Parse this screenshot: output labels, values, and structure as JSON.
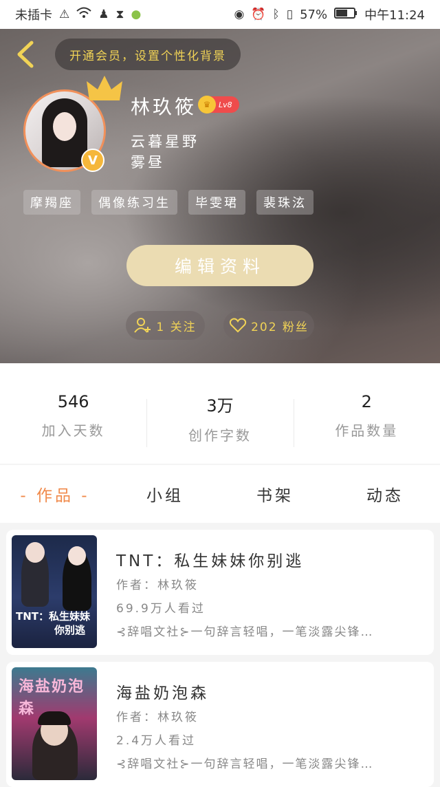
{
  "status_bar": {
    "carrier": "未插卡",
    "battery": "57%",
    "time": "中午11:24"
  },
  "header": {
    "vip_banner": "开通会员，设置个性化背景"
  },
  "profile": {
    "name": "林玖筱",
    "level": "Lv8",
    "bio_line1": "云暮星野",
    "bio_line2": "雾昼",
    "tags": [
      "摩羯座",
      "偶像练习生",
      "毕雯珺",
      "裴珠泫"
    ],
    "edit_button": "编辑资料",
    "follow_label": "1 关注",
    "fans_label": "202 粉丝"
  },
  "stats": [
    {
      "value": "546",
      "label": "加入天数"
    },
    {
      "value": "3万",
      "label": "创作字数"
    },
    {
      "value": "2",
      "label": "作品数量"
    }
  ],
  "tabs": [
    {
      "label": "- 作品 -",
      "active": true
    },
    {
      "label": "小组",
      "active": false
    },
    {
      "label": "书架",
      "active": false
    },
    {
      "label": "动态",
      "active": false
    }
  ],
  "books": [
    {
      "title": "TNT：私生妹妹你别逃",
      "author": "作者：林玖筱",
      "views": "69.9万人看过",
      "desc": "⊰辞唱文社⊱一句辞言轻唱，一笔淡露尖锋…",
      "cover_text_1": "TNT：私生妹妹",
      "cover_text_2": "你别逃"
    },
    {
      "title": "海盐奶泡森",
      "author": "作者：林玖筱",
      "views": "2.4万人看过",
      "desc": "⊰辞唱文社⊱一句辞言轻唱，一笔淡露尖锋…",
      "cover_text_1": "海盐奶泡森"
    }
  ],
  "colors": {
    "accent_orange": "#f08a4b",
    "gold": "#f1d356",
    "edit_button_bg": "#ebdcb2",
    "level_badge": "#ef4c4c"
  }
}
